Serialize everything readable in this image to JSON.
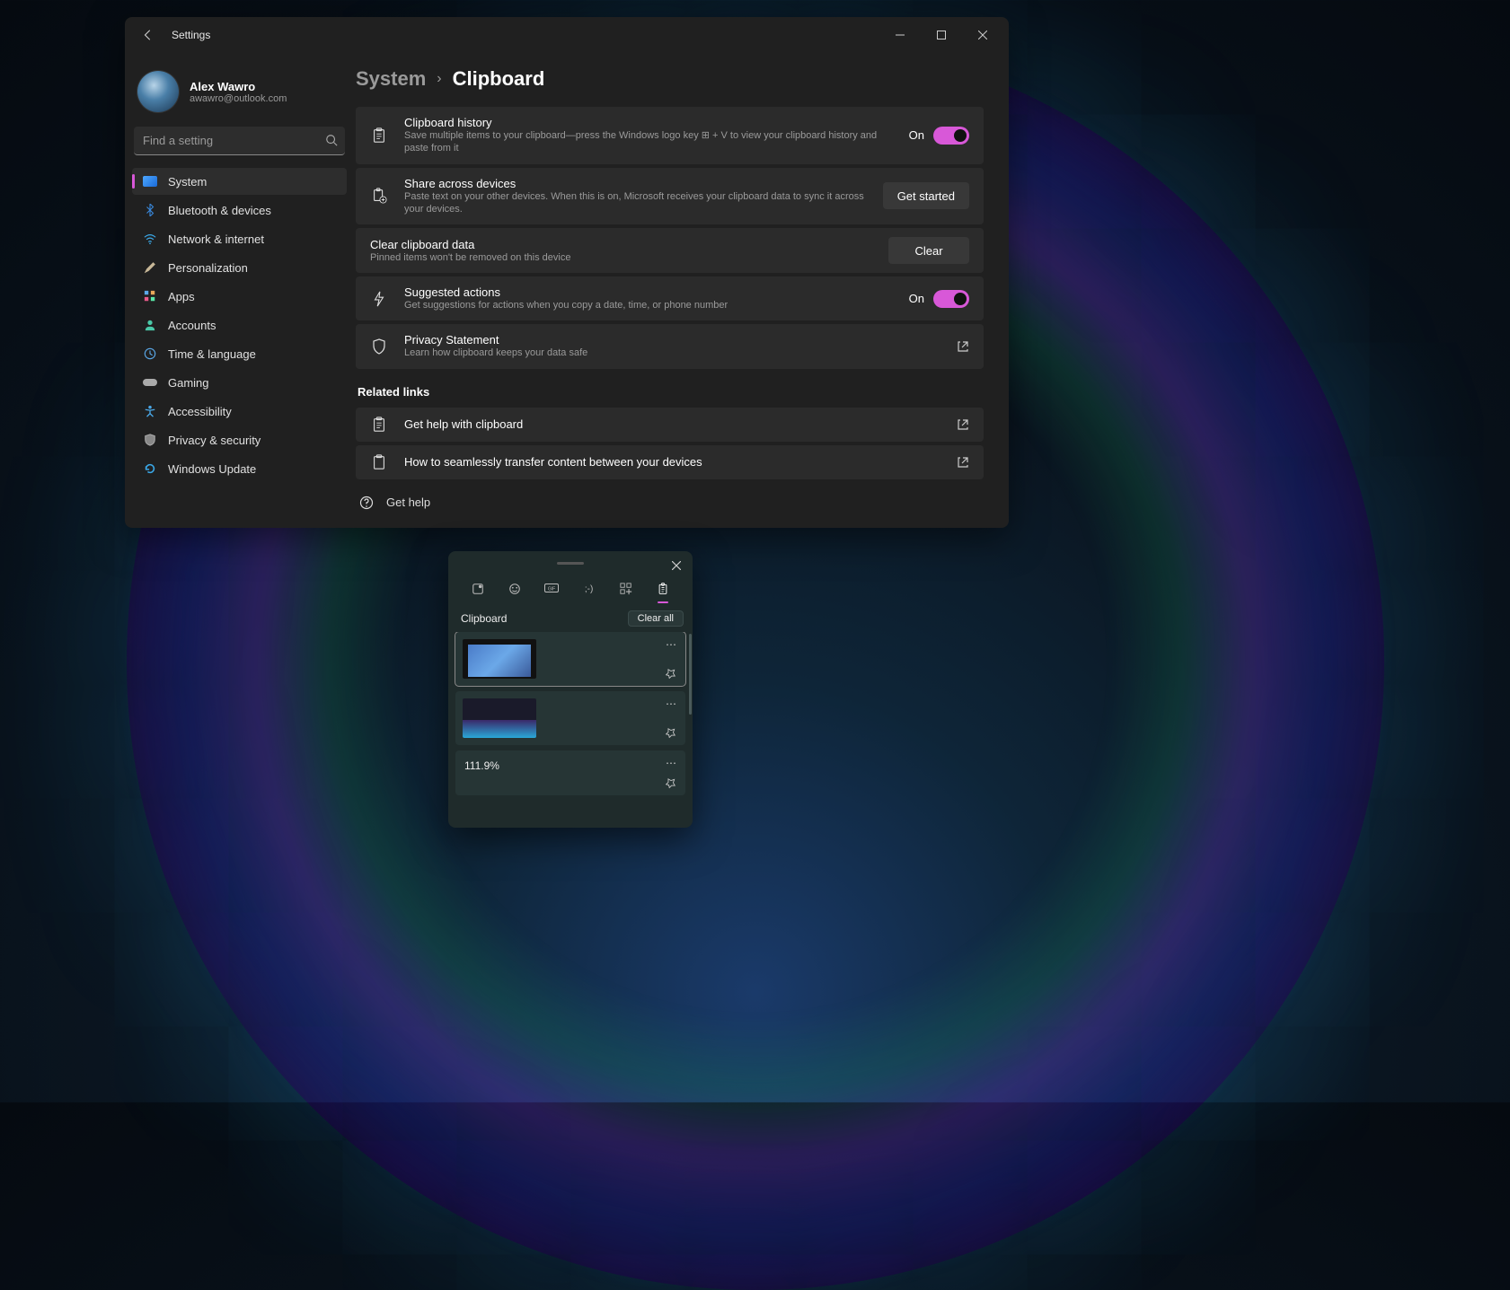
{
  "window": {
    "title": "Settings"
  },
  "profile": {
    "name": "Alex Wawro",
    "email": "awawro@outlook.com"
  },
  "search": {
    "placeholder": "Find a setting"
  },
  "sidebar": {
    "items": [
      {
        "label": "System",
        "icon": "💻",
        "active": true
      },
      {
        "label": "Bluetooth & devices",
        "icon": "bt"
      },
      {
        "label": "Network & internet",
        "icon": "wifi"
      },
      {
        "label": "Personalization",
        "icon": "brush"
      },
      {
        "label": "Apps",
        "icon": "apps"
      },
      {
        "label": "Accounts",
        "icon": "person"
      },
      {
        "label": "Time & language",
        "icon": "clock"
      },
      {
        "label": "Gaming",
        "icon": "game"
      },
      {
        "label": "Accessibility",
        "icon": "access"
      },
      {
        "label": "Privacy & security",
        "icon": "shield"
      },
      {
        "label": "Windows Update",
        "icon": "update"
      }
    ]
  },
  "breadcrumb": {
    "parent": "System",
    "sep": "›",
    "current": "Clipboard"
  },
  "settings": {
    "history": {
      "title": "Clipboard history",
      "sub": "Save multiple items to your clipboard—press the Windows logo key ⊞ + V to view your clipboard history and paste from it",
      "state": "On"
    },
    "share": {
      "title": "Share across devices",
      "sub": "Paste text on your other devices. When this is on, Microsoft receives your clipboard data to sync it across your devices.",
      "button": "Get started"
    },
    "clear": {
      "title": "Clear clipboard data",
      "sub": "Pinned items won't be removed on this device",
      "button": "Clear"
    },
    "suggested": {
      "title": "Suggested actions",
      "sub": "Get suggestions for actions when you copy a date, time, or phone number",
      "state": "On"
    },
    "privacy": {
      "title": "Privacy Statement",
      "sub": "Learn how clipboard keeps your data safe"
    }
  },
  "related": {
    "heading": "Related links",
    "help_clipboard": "Get help with clipboard",
    "transfer": "How to seamlessly transfer content between your devices"
  },
  "footer": {
    "get_help": "Get help"
  },
  "popup": {
    "title": "Clipboard",
    "clear_all": "Clear all",
    "items": [
      {
        "type": "image"
      },
      {
        "type": "image"
      },
      {
        "type": "text",
        "value": "111.9%"
      }
    ]
  }
}
